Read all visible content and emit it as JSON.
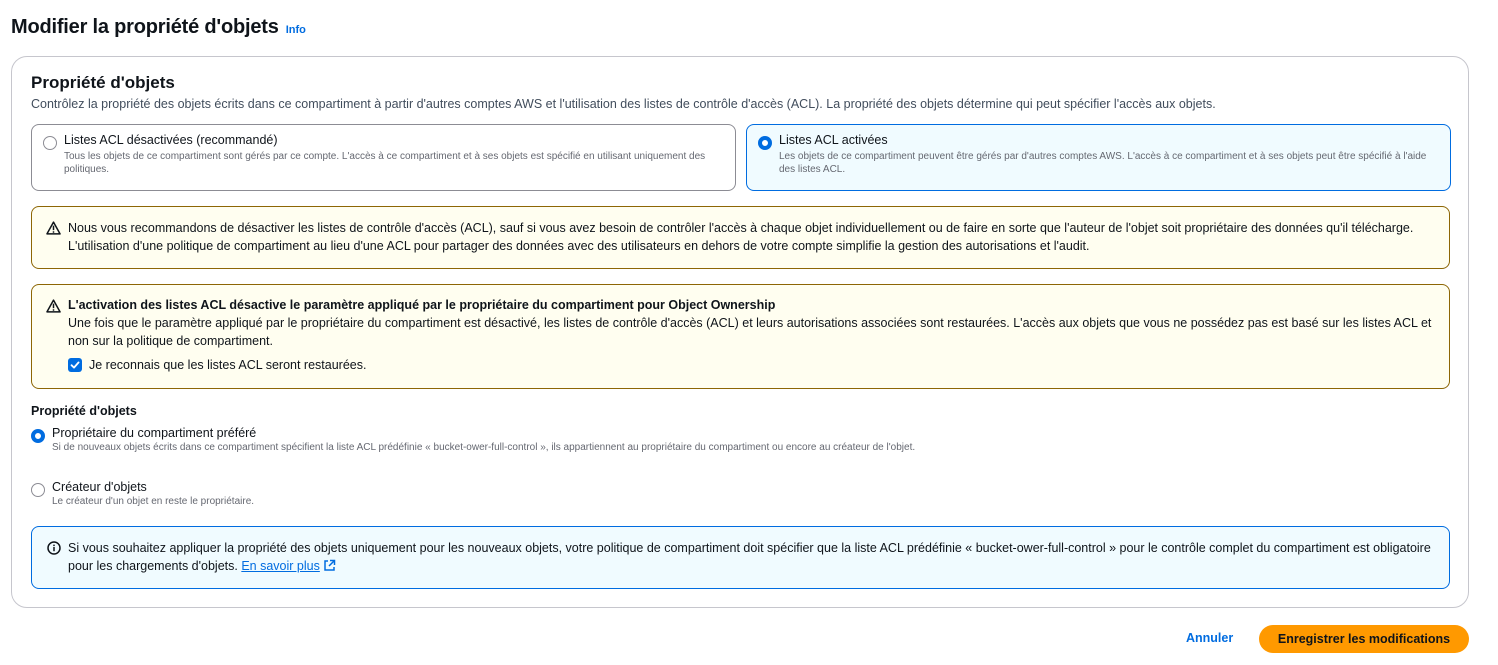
{
  "header": {
    "title": "Modifier la propriété d'objets",
    "info_link": "Info"
  },
  "section": {
    "title": "Propriété d'objets",
    "description": "Contrôlez la propriété des objets écrits dans ce compartiment à partir d'autres comptes AWS et l'utilisation des listes de contrôle d'accès (ACL). La propriété des objets détermine qui peut spécifier l'accès aux objets."
  },
  "acl_options": [
    {
      "label": "Listes ACL désactivées (recommandé)",
      "description": "Tous les objets de ce compartiment sont gérés par ce compte. L'accès à ce compartiment et à ses objets est spécifié en utilisant uniquement des politiques.",
      "selected": false
    },
    {
      "label": "Listes ACL activées",
      "description": "Les objets de ce compartiment peuvent être gérés par d'autres comptes AWS. L'accès à ce compartiment et à ses objets peut être spécifié à l'aide des listes ACL.",
      "selected": true
    }
  ],
  "warning_recommend": {
    "icon": "warning-icon",
    "text": "Nous vous recommandons de désactiver les listes de contrôle d'accès (ACL), sauf si vous avez besoin de contrôler l'accès à chaque objet individuellement ou de faire en sorte que l'auteur de l'objet soit propriétaire des données qu'il télécharge. L'utilisation d'une politique de compartiment au lieu d'une ACL pour partager des données avec des utilisateurs en dehors de votre compte simplifie la gestion des autorisations et l'audit."
  },
  "warning_activation": {
    "icon": "warning-icon",
    "heading": "L'activation des listes ACL désactive le paramètre appliqué par le propriétaire du compartiment pour Object Ownership",
    "body": "Une fois que le paramètre appliqué par le propriétaire du compartiment est désactivé, les listes de contrôle d'accès (ACL) et leurs autorisations associées sont restaurées. L'accès aux objets que vous ne possédez pas est basé sur les listes ACL et non sur la politique de compartiment.",
    "ack_label": "Je reconnais que les listes ACL seront restaurées.",
    "ack_checked": true
  },
  "ownership": {
    "title": "Propriété d'objets",
    "options": [
      {
        "label": "Propriétaire du compartiment préféré",
        "description": "Si de nouveaux objets écrits dans ce compartiment spécifient la liste ACL prédéfinie « bucket-ower-full-control », ils appartiennent au propriétaire du compartiment ou encore au créateur de l'objet.",
        "selected": true
      },
      {
        "label": "Créateur d'objets",
        "description": "Le créateur d'un objet en reste le propriétaire.",
        "selected": false
      }
    ]
  },
  "info_alert": {
    "icon": "info-icon",
    "text": "Si vous souhaitez appliquer la propriété des objets uniquement pour les nouveaux objets, votre politique de compartiment doit spécifier que la liste ACL prédéfinie « bucket-ower-full-control » pour le contrôle complet du compartiment est obligatoire pour les chargements d'objets.",
    "link_label": "En savoir plus"
  },
  "footer": {
    "cancel_label": "Annuler",
    "save_label": "Enregistrer les modifications"
  },
  "colors": {
    "accent": "#006ce0",
    "warning_border": "#8d6605",
    "primary_button": "#ff9900"
  }
}
